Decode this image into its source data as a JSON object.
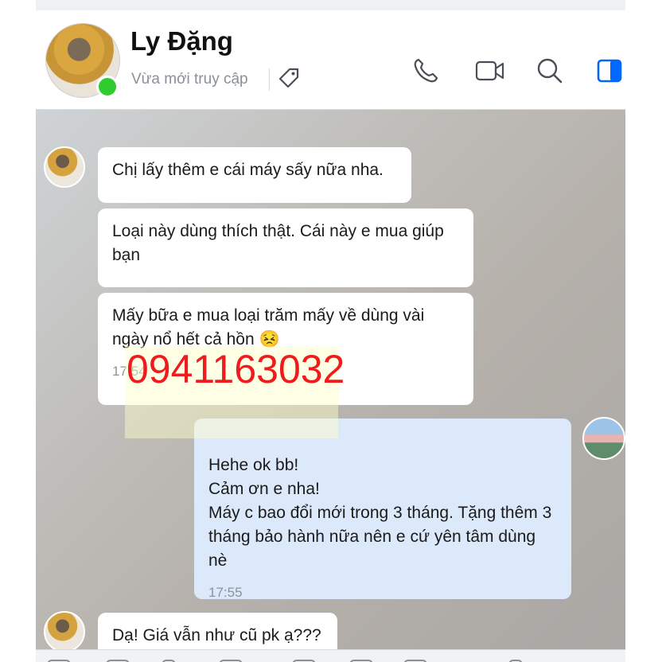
{
  "header": {
    "contact_name": "Ly Đặng",
    "status": "Vừa mới truy cập",
    "icons": [
      "tag-icon",
      "phone-icon",
      "video-icon",
      "search-icon",
      "sidebar-toggle-icon"
    ],
    "accent": "#0068ff"
  },
  "watermark": {
    "phone_number": "0941163032",
    "color": "#ee1c1c"
  },
  "messages": [
    {
      "from": "contact",
      "text": "Chị lấy thêm e cái máy sấy nữa nha."
    },
    {
      "from": "contact",
      "text": "Loại này dùng thích thật. Cái này e mua giúp bạn"
    },
    {
      "from": "contact",
      "text": "Mấy bữa e mua loại trăm mấy về dùng vài ngày nổ hết cả hồn 😣",
      "time": "17:54"
    },
    {
      "from": "me",
      "text": "Hehe ok bb!\nCảm ơn e nha!\nMáy c bao đổi mới trong 3 tháng. Tặng thêm 3 tháng bảo hành nữa nên e cứ yên tâm dùng nè",
      "time": "17:55"
    },
    {
      "from": "contact",
      "text": "Dạ! Giá vẫn như cũ pk ạ???"
    }
  ]
}
